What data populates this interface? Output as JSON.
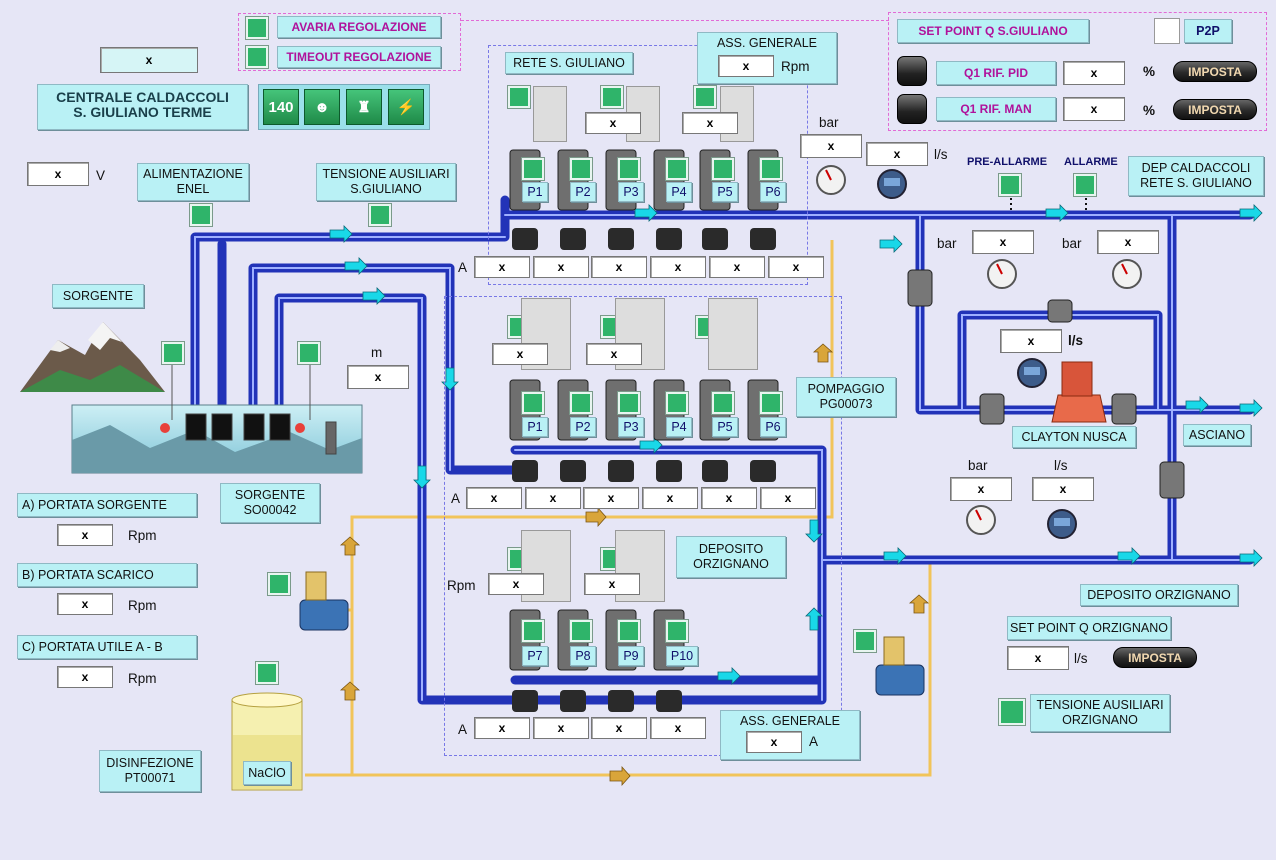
{
  "placeholder": "x",
  "alarms": {
    "avaria": "AVARIA REGOLAZIONE",
    "timeout": "TIMEOUT REGOLAZIONE"
  },
  "header": {
    "title_line1": "CENTRALE CALDACCOLI",
    "title_line2": "S. GIULIANO TERME",
    "counter": "140"
  },
  "setpoint_sg": {
    "title": "SET POINT Q S.GIULIANO",
    "p2p": "P2P",
    "pid_label": "Q1  RIF. PID",
    "man_label": "Q1  RIF. MAN",
    "unit": "%",
    "btn": "IMPOSTA"
  },
  "rete": {
    "title": "RETE S. GIULIANO",
    "ass_title": "ASS. GENERALE",
    "ass_unit": "Rpm",
    "amp_unit": "A"
  },
  "pumps_top": [
    "P1",
    "P2",
    "P3",
    "P4",
    "P5",
    "P6"
  ],
  "pumps_mid": [
    "P1",
    "P2",
    "P3",
    "P4",
    "P5",
    "P6"
  ],
  "pumps_low": [
    "P7",
    "P8",
    "P9",
    "P10"
  ],
  "left": {
    "volt_unit": "V",
    "alim": "ALIMENTAZIONE ENEL",
    "tens_sg": "TENSIONE AUSILIARI S.GIULIANO",
    "sorgente": "SORGENTE",
    "sorgente_code": "SORGENTE SO00042",
    "level_unit": "m",
    "portata_a": "A) PORTATA SORGENTE",
    "portata_b": "B) PORTATA SCARICO",
    "portata_c": "C) PORTATA UTILE A - B",
    "rpm": "Rpm",
    "disinf": "DISINFEZIONE PT00071",
    "naclo": "NaClO"
  },
  "right": {
    "bar": "bar",
    "ls": "l/s",
    "ls_bold": "l/s",
    "pre_allarme": "PRE-ALLARME",
    "allarme": "ALLARME",
    "dep_cald": "DEP CALDACCOLI RETE S. GIULIANO",
    "clayton": "CLAYTON NUSCA",
    "asciano": "ASCIANO",
    "pompaggio": "POMPAGGIO PG00073",
    "deposito_orz": "DEPOSITO ORZIGNANO",
    "deposito_orz2": "DEPOSITO ORZIGNANO",
    "sp_orz": "SET POINT Q ORZIGNANO",
    "imposta": "IMPOSTA",
    "tens_orz": "TENSIONE AUSILIARI ORZIGNANO",
    "ass_generale_a": "ASS. GENERALE",
    "rpm": "Rpm"
  },
  "colors": {
    "background": "#e6e6f6",
    "pipe": "#3b4fd8",
    "label_bg": "#b9f1f5",
    "status_ok": "#2fb46a",
    "chem_line": "#f1c45a",
    "alarm_border": "#e26ad6"
  }
}
